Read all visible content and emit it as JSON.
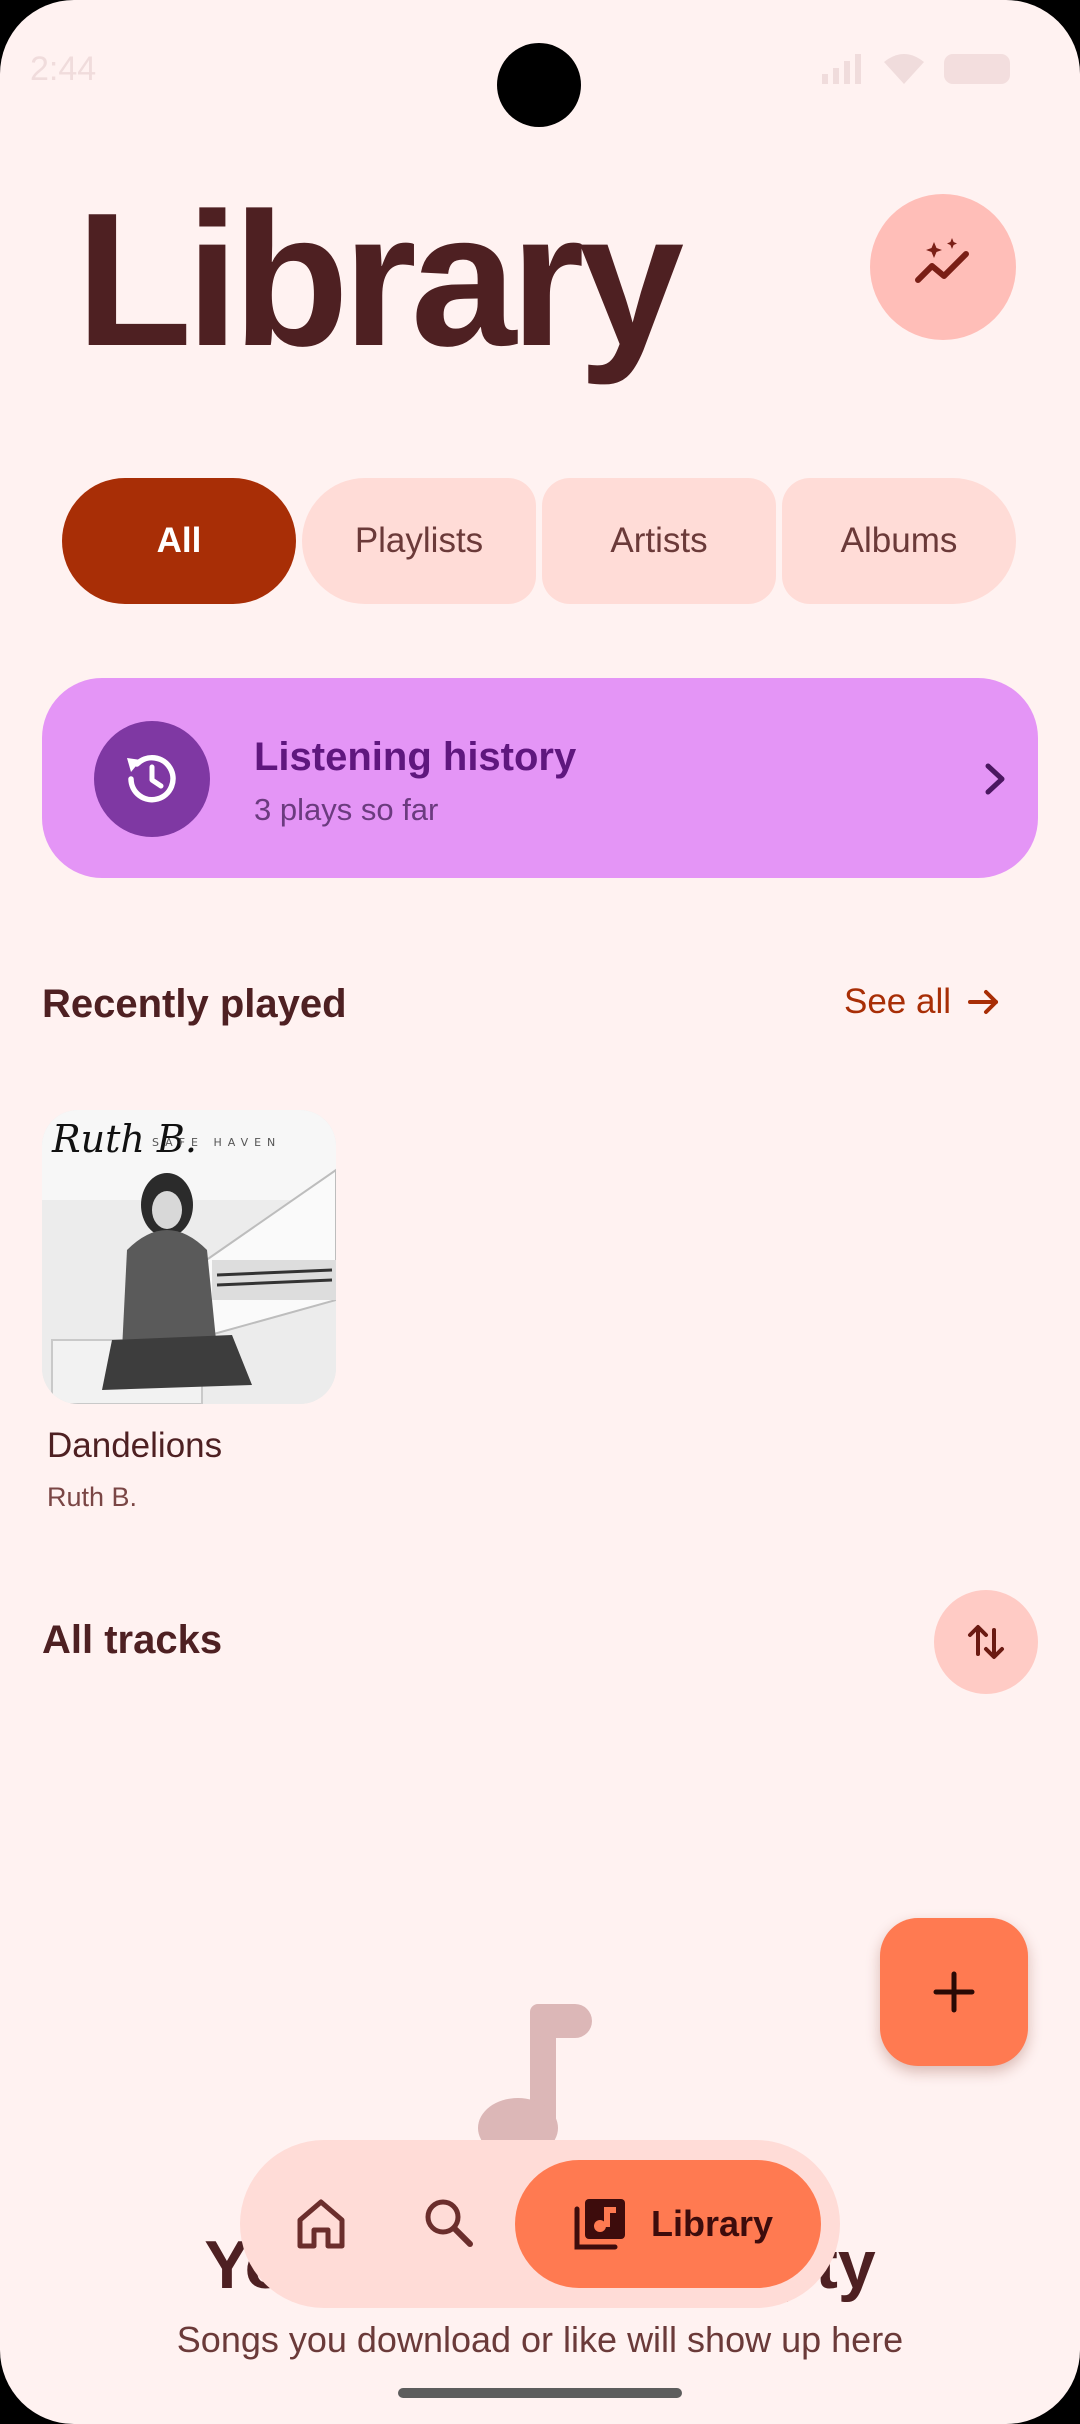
{
  "status_bar": {
    "time": "2:44"
  },
  "header": {
    "title": "Library"
  },
  "filters": {
    "chips": [
      {
        "label": "All",
        "selected": true
      },
      {
        "label": "Playlists",
        "selected": false
      },
      {
        "label": "Artists",
        "selected": false
      },
      {
        "label": "Albums",
        "selected": false
      }
    ]
  },
  "history": {
    "title": "Listening history",
    "subtitle": "3 plays so far"
  },
  "recently_played": {
    "heading": "Recently played",
    "see_all": "See all",
    "items": [
      {
        "title": "Dandelions",
        "artist": "Ruth B.",
        "art_script": "Ruth B.",
        "art_caption": "SAFE HAVEN"
      }
    ]
  },
  "all_tracks": {
    "heading": "All tracks",
    "empty_title": "Your library is empty",
    "empty_subtitle": "Songs you download or like will show up here"
  },
  "bottom_nav": {
    "active_label": "Library"
  },
  "colors": {
    "background": "#fff2f1",
    "accent": "#a82e06",
    "chip": "#ffdcd7",
    "history_card": "#e495f6",
    "history_icon": "#7f38a3",
    "fab": "#ff7a51",
    "title_text": "#4e2022"
  }
}
